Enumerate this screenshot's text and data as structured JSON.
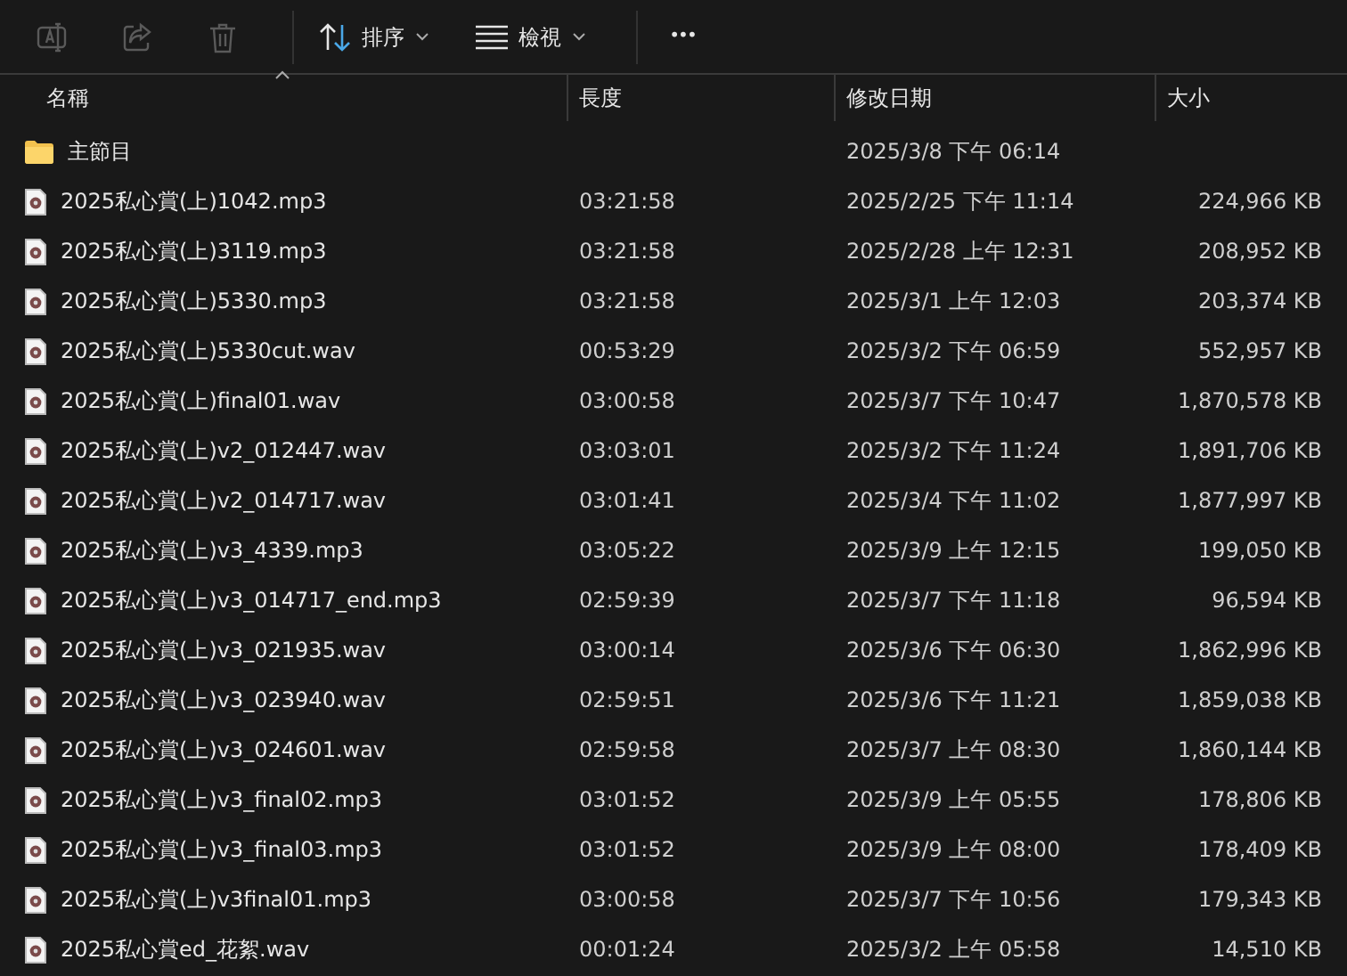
{
  "toolbar": [
    {
      "kind": "rename",
      "disabled": true
    },
    {
      "kind": "share",
      "disabled": true
    },
    {
      "kind": "delete",
      "disabled": true
    },
    {
      "kind": "sort",
      "label": "排序",
      "disabled": false
    },
    {
      "kind": "view",
      "label": "檢視",
      "disabled": false
    },
    {
      "kind": "more",
      "label": "•••",
      "disabled": false
    }
  ],
  "columns": [
    {
      "label": "名稱",
      "sorted": true
    },
    {
      "label": "長度",
      "sorted": false
    },
    {
      "label": "修改日期",
      "sorted": false
    },
    {
      "label": "大小",
      "sorted": false
    }
  ],
  "rows": [
    {
      "kind": "folder",
      "name": "主節目",
      "length": "",
      "modified": "2025/3/8 下午 06:14",
      "size": ""
    },
    {
      "kind": "audio",
      "name": "2025私心賞(上)1042.mp3",
      "length": "03:21:58",
      "modified": "2025/2/25 下午 11:14",
      "size": "224,966 KB"
    },
    {
      "kind": "audio",
      "name": "2025私心賞(上)3119.mp3",
      "length": "03:21:58",
      "modified": "2025/2/28 上午 12:31",
      "size": "208,952 KB"
    },
    {
      "kind": "audio",
      "name": "2025私心賞(上)5330.mp3",
      "length": "03:21:58",
      "modified": "2025/3/1 上午 12:03",
      "size": "203,374 KB"
    },
    {
      "kind": "audio",
      "name": "2025私心賞(上)5330cut.wav",
      "length": "00:53:29",
      "modified": "2025/3/2 下午 06:59",
      "size": "552,957 KB"
    },
    {
      "kind": "audio",
      "name": "2025私心賞(上)final01.wav",
      "length": "03:00:58",
      "modified": "2025/3/7 下午 10:47",
      "size": "1,870,578 KB"
    },
    {
      "kind": "audio",
      "name": "2025私心賞(上)v2_012447.wav",
      "length": "03:03:01",
      "modified": "2025/3/2 下午 11:24",
      "size": "1,891,706 KB"
    },
    {
      "kind": "audio",
      "name": "2025私心賞(上)v2_014717.wav",
      "length": "03:01:41",
      "modified": "2025/3/4 下午 11:02",
      "size": "1,877,997 KB"
    },
    {
      "kind": "audio",
      "name": "2025私心賞(上)v3_4339.mp3",
      "length": "03:05:22",
      "modified": "2025/3/9 上午 12:15",
      "size": "199,050 KB"
    },
    {
      "kind": "audio",
      "name": "2025私心賞(上)v3_014717_end.mp3",
      "length": "02:59:39",
      "modified": "2025/3/7 下午 11:18",
      "size": "96,594 KB"
    },
    {
      "kind": "audio",
      "name": "2025私心賞(上)v3_021935.wav",
      "length": "03:00:14",
      "modified": "2025/3/6 下午 06:30",
      "size": "1,862,996 KB"
    },
    {
      "kind": "audio",
      "name": "2025私心賞(上)v3_023940.wav",
      "length": "02:59:51",
      "modified": "2025/3/6 下午 11:21",
      "size": "1,859,038 KB"
    },
    {
      "kind": "audio",
      "name": "2025私心賞(上)v3_024601.wav",
      "length": "02:59:58",
      "modified": "2025/3/7 上午 08:30",
      "size": "1,860,144 KB"
    },
    {
      "kind": "audio",
      "name": "2025私心賞(上)v3_final02.mp3",
      "length": "03:01:52",
      "modified": "2025/3/9 上午 05:55",
      "size": "178,806 KB"
    },
    {
      "kind": "audio",
      "name": "2025私心賞(上)v3_final03.mp3",
      "length": "03:01:52",
      "modified": "2025/3/9 上午 08:00",
      "size": "178,409 KB"
    },
    {
      "kind": "audio",
      "name": "2025私心賞(上)v3final01.mp3",
      "length": "03:00:58",
      "modified": "2025/3/7 下午 10:56",
      "size": "179,343 KB"
    },
    {
      "kind": "audio",
      "name": "2025私心賞ed_花絮.wav",
      "length": "00:01:24",
      "modified": "2025/3/2 上午 05:58",
      "size": "14,510 KB"
    }
  ]
}
